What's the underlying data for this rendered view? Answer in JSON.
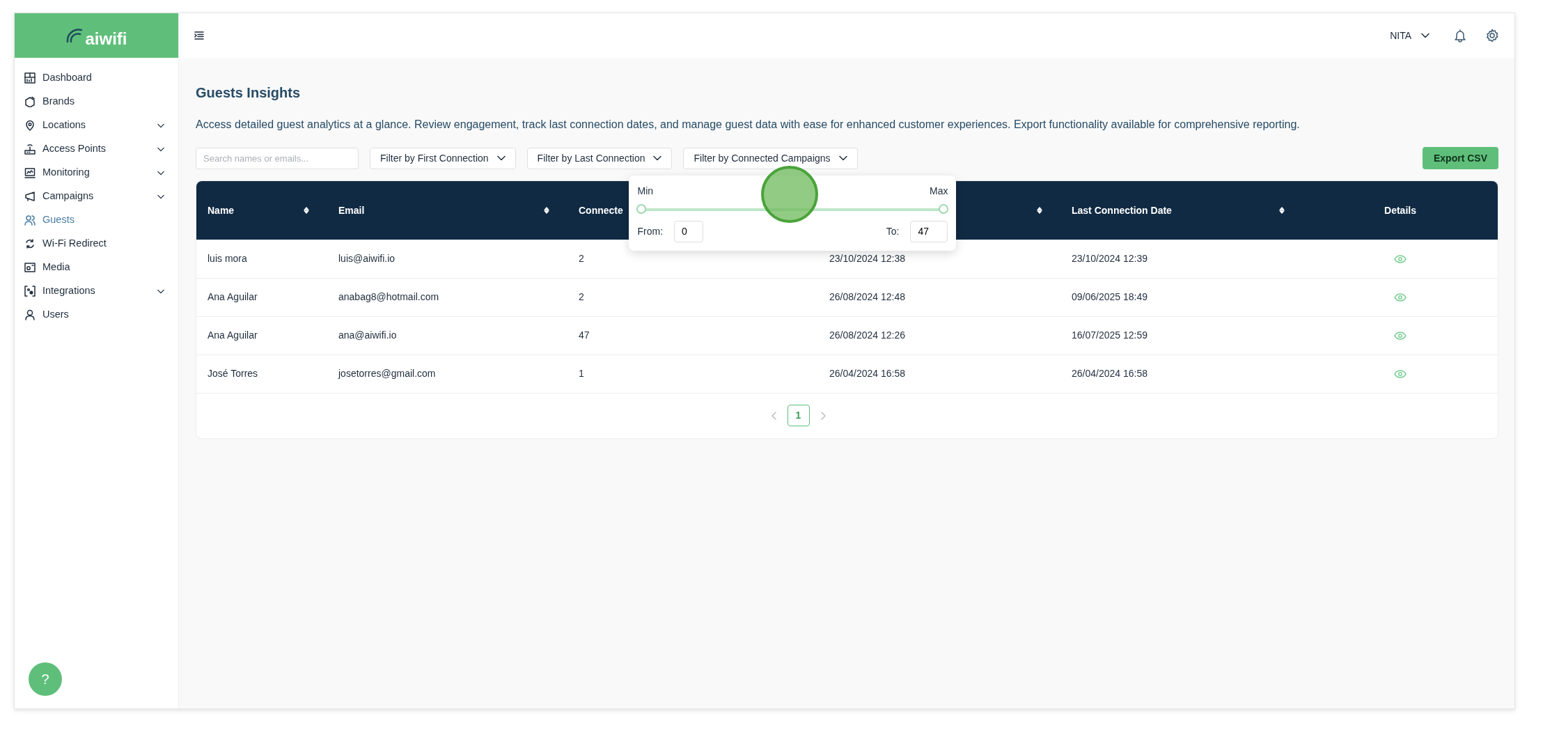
{
  "logo": {
    "text": "aiwifi"
  },
  "sidebar": {
    "items": [
      {
        "label": "Dashboard",
        "selected": false,
        "expandable": false
      },
      {
        "label": "Brands",
        "selected": false,
        "expandable": false
      },
      {
        "label": "Locations",
        "selected": false,
        "expandable": true
      },
      {
        "label": "Access Points",
        "selected": false,
        "expandable": true
      },
      {
        "label": "Monitoring",
        "selected": false,
        "expandable": true
      },
      {
        "label": "Campaigns",
        "selected": false,
        "expandable": true
      },
      {
        "label": "Guests",
        "selected": true,
        "expandable": false
      },
      {
        "label": "Wi-Fi Redirect",
        "selected": false,
        "expandable": false
      },
      {
        "label": "Media",
        "selected": false,
        "expandable": false
      },
      {
        "label": "Integrations",
        "selected": false,
        "expandable": true
      },
      {
        "label": "Users",
        "selected": false,
        "expandable": false
      }
    ]
  },
  "header": {
    "user": "NITA"
  },
  "page": {
    "title": "Guests Insights",
    "description": "Access detailed guest analytics at a glance. Review engagement, track last connection dates, and manage guest data with ease for enhanced customer experiences. Export functionality available for comprehensive reporting."
  },
  "search": {
    "placeholder": "Search names or emails..."
  },
  "filters": [
    {
      "label": "Filter by First Connection"
    },
    {
      "label": "Filter by Last Connection"
    },
    {
      "label": "Filter by Connected Campaigns",
      "range_popover": {
        "min_label": "Min",
        "max_label": "Max",
        "thumbs": [
          {
            "level": 0
          },
          {
            "level": 1
          }
        ],
        "from_label": "From:",
        "from_value": "0",
        "to_label": "To:",
        "to_value": "47"
      }
    }
  ],
  "export_button": "Export CSV",
  "table": {
    "columns": [
      {
        "label": "Name",
        "sortable": true
      },
      {
        "label": "Email",
        "sortable": true
      },
      {
        "label": "Connecte",
        "sortable": false
      },
      {
        "sortable": true
      },
      {
        "label": "Last Connection Date",
        "sortable": true
      },
      {
        "label": "Details",
        "sortable": false
      }
    ],
    "rows": [
      {
        "cells": [
          "luis mora",
          "luis@aiwifi.io",
          "2",
          "23/10/2024 12:38",
          "23/10/2024 12:39"
        ]
      },
      {
        "cells": [
          "Ana Aguilar",
          "anabag8@hotmail.com",
          "2",
          "26/08/2024 12:48",
          "09/06/2025 18:49"
        ]
      },
      {
        "cells": [
          "Ana Aguilar",
          "ana@aiwifi.io",
          "47",
          "26/08/2024 12:26",
          "16/07/2025 12:59"
        ]
      },
      {
        "cells": [
          "José Torres",
          "josetorres@gmail.com",
          "1",
          "26/04/2024 16:58",
          "26/04/2024 16:58"
        ]
      }
    ]
  },
  "pagination": {
    "pages": [
      {
        "label": "1",
        "selected": true
      }
    ]
  },
  "help_button": "?"
}
